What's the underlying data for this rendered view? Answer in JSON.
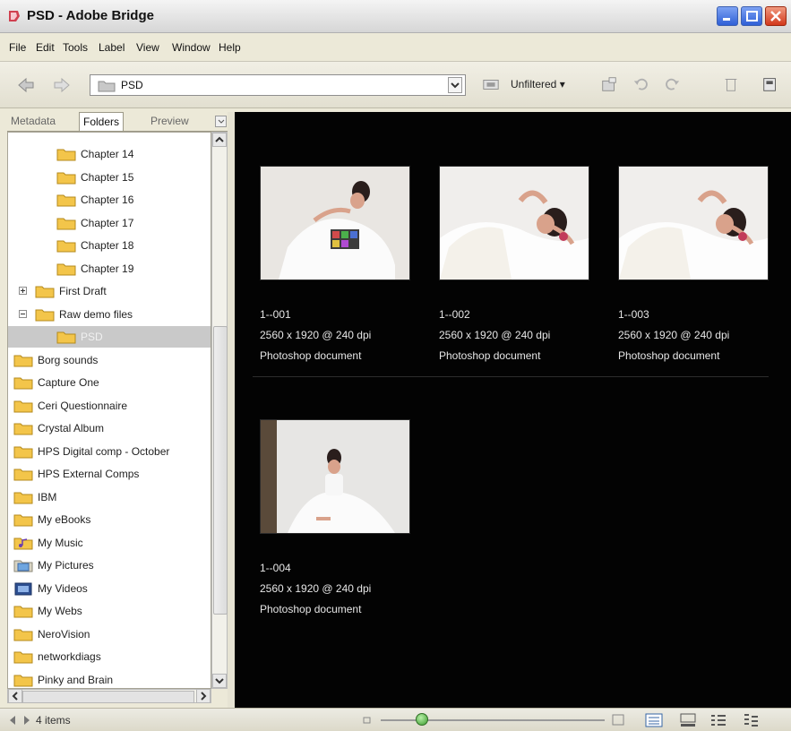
{
  "window": {
    "title": "PSD - Adobe Bridge"
  },
  "menu": [
    "File",
    "Edit",
    "Tools",
    "Label",
    "View",
    "Window",
    "Help"
  ],
  "toolbar": {
    "path": "PSD",
    "filter_label": "Unfiltered"
  },
  "panel_tabs": [
    "Metadata",
    "Folders",
    "Preview"
  ],
  "folder_tree": [
    {
      "label": "Chapter 14",
      "indent": 2
    },
    {
      "label": "Chapter 15",
      "indent": 2
    },
    {
      "label": "Chapter 16",
      "indent": 2
    },
    {
      "label": "Chapter 17",
      "indent": 2
    },
    {
      "label": "Chapter 18",
      "indent": 2
    },
    {
      "label": "Chapter 19",
      "indent": 2
    },
    {
      "label": "First Draft",
      "indent": 1,
      "expander": "plus"
    },
    {
      "label": "Raw demo files",
      "indent": 1,
      "expander": "minus"
    },
    {
      "label": "PSD",
      "indent": 2,
      "selected": true
    },
    {
      "label": "Borg sounds",
      "indent": 0
    },
    {
      "label": "Capture One",
      "indent": 0
    },
    {
      "label": "Ceri Questionnaire",
      "indent": 0
    },
    {
      "label": "Crystal Album",
      "indent": 0
    },
    {
      "label": "HPS Digital comp - October",
      "indent": 0
    },
    {
      "label": "HPS External Comps",
      "indent": 0
    },
    {
      "label": "IBM",
      "indent": 0
    },
    {
      "label": "My eBooks",
      "indent": 0
    },
    {
      "label": "My Music",
      "indent": 0,
      "icon": "music-folder-icon"
    },
    {
      "label": "My Pictures",
      "indent": 0,
      "icon": "pictures-folder-icon"
    },
    {
      "label": "My Videos",
      "indent": 0,
      "icon": "videos-folder-icon"
    },
    {
      "label": "My Webs",
      "indent": 0
    },
    {
      "label": "NeroVision",
      "indent": 0
    },
    {
      "label": "networkdiags",
      "indent": 0
    },
    {
      "label": "Pinky and Brain",
      "indent": 0
    }
  ],
  "thumbnails": [
    {
      "name": "1--001",
      "size": "2560 x 1920 @ 240 dpi",
      "type": "Photoshop document"
    },
    {
      "name": "1--002",
      "size": "2560 x 1920 @ 240 dpi",
      "type": "Photoshop document"
    },
    {
      "name": "1--003",
      "size": "2560 x 1920 @ 240 dpi",
      "type": "Photoshop document"
    },
    {
      "name": "1--004",
      "size": "2560 x 1920 @ 240 dpi",
      "type": "Photoshop document"
    }
  ],
  "status": {
    "item_count": "4 items",
    "thumbnail_size": 0.18
  },
  "colors": {
    "content_bg": "#030303",
    "folder_yellow": "#f3c54a",
    "selected_row": "#c9c9c9"
  }
}
